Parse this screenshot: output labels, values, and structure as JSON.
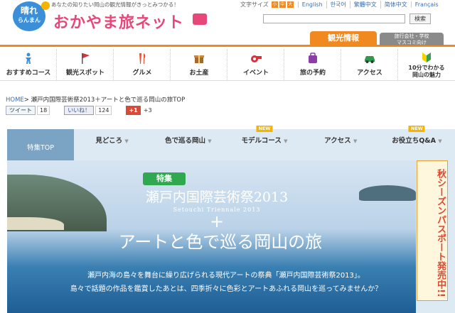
{
  "header": {
    "logo_line1": "晴れ",
    "logo_line2": "らんまん",
    "tagline": "あなたの知りたい岡山の観光情報がきっとみつかる！",
    "site_title": "おかやま旅ネット",
    "font_size_label": "文字サイズ",
    "font_sizes": [
      "小",
      "中",
      "大"
    ],
    "languages": [
      "English",
      "한국어",
      "繁體中文",
      "简体中文",
      "Français"
    ],
    "search_placeholder": "",
    "search_button": "検索"
  },
  "tabs": {
    "tourism": "観光情報",
    "travel_line1": "旅行会社・学校",
    "travel_line2": "マスコミ向け"
  },
  "nav": [
    {
      "label": "おすすめコース",
      "icon": "person-icon",
      "color": "#3a8fd8"
    },
    {
      "label": "観光スポット",
      "icon": "flag-icon",
      "color": "#d9303a"
    },
    {
      "label": "グルメ",
      "icon": "cutlery-icon",
      "color": "#e8502d"
    },
    {
      "label": "お土産",
      "icon": "gift-icon",
      "color": "#a46a2b"
    },
    {
      "label": "イベント",
      "icon": "whistle-icon",
      "color": "#d9303a"
    },
    {
      "label": "旅の予約",
      "icon": "suitcase-icon",
      "color": "#8b3fa6"
    },
    {
      "label": "アクセス",
      "icon": "car-icon",
      "color": "#2f9a4d"
    },
    {
      "label_line1": "10分でわかる",
      "label_line2": "岡山の魅力",
      "icon": "beginner-icon",
      "color": "#3aa04f"
    }
  ],
  "breadcrumb": {
    "home": "HOME",
    "current": "> 瀬戸内国際芸術祭2013＋アートと色で巡る岡山の旅TOP"
  },
  "social": {
    "tweet": "ツイート",
    "tweet_count": "18",
    "like": "いいね！",
    "like_count": "124",
    "gplus": "+1",
    "gplus_count": "+3"
  },
  "feature_menu": {
    "top_tab": "特集TOP",
    "items": [
      {
        "label": "見どころ",
        "new": ""
      },
      {
        "label": "色で巡る岡山",
        "new": ""
      },
      {
        "label": "モデルコース",
        "new": "NEW"
      },
      {
        "label": "アクセス",
        "new": ""
      },
      {
        "label": "お役立ちQ&A",
        "new": "NEW"
      }
    ]
  },
  "hero": {
    "badge": "特集",
    "title": "瀬戸内国際芸術祭2013",
    "subtitle": "Setouchi Triennale 2013",
    "plus": "+",
    "title2": "アートと色で巡る岡山の旅",
    "desc1": "瀬戸内海の島々を舞台に繰り広げられる現代アートの祭典「瀬戸内国際芸術祭2013」。",
    "desc2": "島々で話題の作品を鑑賞したあとは、四季折々に色彩とアートあふれる岡山を巡ってみませんか？"
  },
  "side_promo": "秋シーズンパスポート発売中!!"
}
